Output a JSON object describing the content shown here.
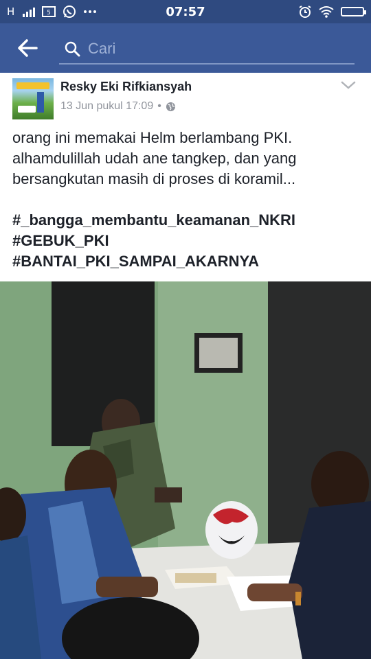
{
  "status_bar": {
    "network": "H",
    "time": "07:57"
  },
  "search": {
    "placeholder": "Cari"
  },
  "post": {
    "author": "Resky Eki Rifkiansyah",
    "timestamp": "13 Jun pukul 17:09",
    "separator": "•",
    "privacy_icon": "globe-icon",
    "text_lines": [
      "orang ini memakai Helm berlambang PKI.",
      "alhamdulillah udah ane tangkep, dan yang",
      "bersangkutan masih di proses di koramil..."
    ],
    "hashtags": [
      "#_bangga_membantu_keamanan_NKRI",
      "#GEBUK_PKI",
      "#BANTAI_PKI_SAMPAI_AKARNYA"
    ]
  },
  "colors": {
    "status_bar": "#2f4a80",
    "header": "#3b5998",
    "feed_bg": "#e9ebee",
    "text": "#1d2129",
    "muted": "#90949c"
  }
}
